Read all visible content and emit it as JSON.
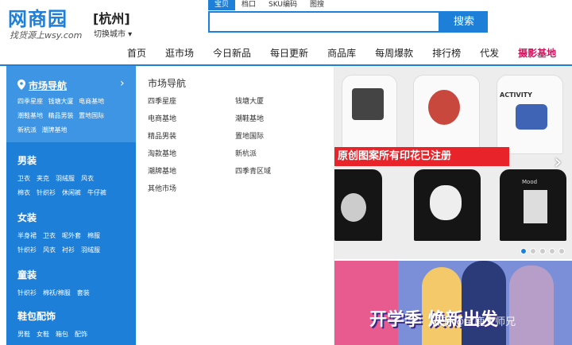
{
  "logo": {
    "title": "网商园",
    "slogan": "找货源上wsy.com"
  },
  "city": {
    "name": "[杭州]",
    "switch": "切换城市 ▾"
  },
  "search": {
    "tabs": [
      "宝贝",
      "档口",
      "SKU编码",
      "图搜"
    ],
    "placeholder": "",
    "button": "搜索"
  },
  "nav": [
    "首页",
    "逛市场",
    "今日新品",
    "每日更新",
    "商品库",
    "每周爆款",
    "排行榜",
    "代发",
    "摄影基地"
  ],
  "sidebar": {
    "market": {
      "title": "市场导航",
      "items": [
        "四季星座",
        "钱塘大厦",
        "电商基地",
        "潮鞋基地",
        "精品男装",
        "置地国际",
        "新杭派",
        "潮牌基地"
      ]
    },
    "groups": [
      {
        "title": "男装",
        "items": [
          "卫衣",
          "夹克",
          "羽绒服",
          "风衣",
          "棉衣",
          "针织衫",
          "休闲裤",
          "牛仔裤"
        ]
      },
      {
        "title": "女装",
        "items": [
          "半身裙",
          "卫衣",
          "呢外套",
          "棉服",
          "针织衫",
          "风衣",
          "衬衫",
          "羽绒服"
        ]
      },
      {
        "title": "童装",
        "items": [
          "针织衫",
          "棉袄/棉服",
          "套装"
        ]
      },
      {
        "title": "鞋包配饰",
        "items": [
          "男鞋",
          "女鞋",
          "箱包",
          "配饰"
        ]
      }
    ]
  },
  "panel": {
    "title": "市场导航",
    "col1": [
      "四季星座",
      "电商基地",
      "精品男装",
      "淘款基地",
      "潮牌基地",
      "其他市场"
    ],
    "col2": [
      "钱塘大厦",
      "潮鞋基地",
      "置地国际",
      "新杭派",
      "四季青区域"
    ]
  },
  "banner1": {
    "text": "原创图案所有印花已注册",
    "shirt_texts": [
      "ACTIVITY",
      "Mood"
    ]
  },
  "banner2": {
    "text": "开学季 焕新出发",
    "watermark": "知乎 @宝鹿大师兄"
  },
  "colors": {
    "brand": "#1e7fd9",
    "accent": "#d4135f"
  }
}
